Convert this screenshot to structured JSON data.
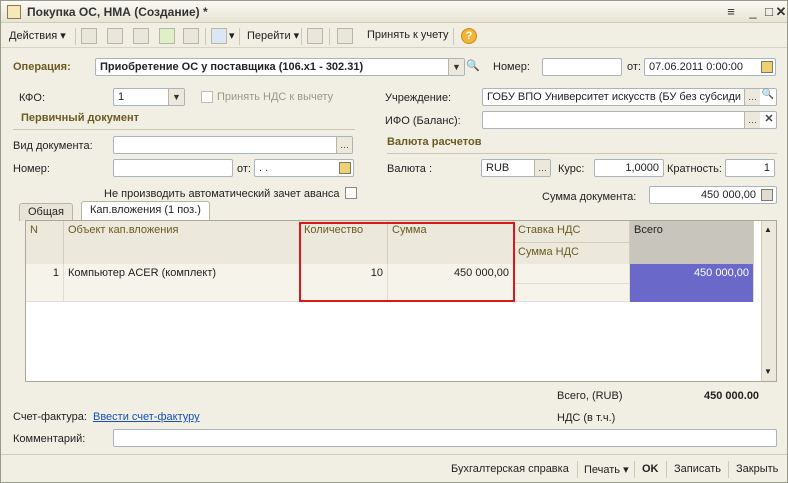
{
  "window": {
    "title": "Покупка ОС, НМА (Создание) *"
  },
  "toolbar": {
    "actions": "Действия",
    "goto": "Перейти",
    "accept_accounting": "Принять к учету",
    "help": "?"
  },
  "header": {
    "operation_label": "Операция:",
    "operation_value": "Приобретение ОС у поставщика (106.x1 - 302.31)",
    "number_label": "Номер:",
    "number_value": "",
    "date_label": "от:",
    "date_value": "07.06.2011  0:00:00",
    "kfo_label": "КФО:",
    "kfo_value": "1",
    "vat_checkbox_label": "Принять НДС к вычету",
    "institution_label": "Учреждение:",
    "institution_value": "ГОБУ ВПО Университет искусств (БУ без субсиди",
    "ifo_label": "ИФО (Баланс):",
    "ifo_value": ""
  },
  "primary_doc": {
    "section_title": "Первичный документ",
    "doc_type_label": "Вид документа:",
    "doc_type_value": "",
    "number_label": "Номер:",
    "number_value": "",
    "date_label": "от:",
    "date_value": " .  .  "
  },
  "currency": {
    "section_title": "Валюта расчетов",
    "currency_label": "Валюта :",
    "currency_value": "RUB",
    "rate_label": "Курс:",
    "rate_value": "1,0000",
    "multiplicity_label": "Кратность:",
    "multiplicity_value": "1",
    "doc_sum_label": "Сумма документа:",
    "doc_sum_value": "450 000,00"
  },
  "advance_checkbox_label": "Не производить автоматический зачет аванса",
  "tabs": [
    {
      "label": "Общая"
    },
    {
      "label": "Кап.вложения (1 поз.)"
    }
  ],
  "grid": {
    "headers": {
      "n": "N",
      "object": "Объект кап.вложения",
      "quantity": "Количество",
      "sum": "Сумма",
      "vat_rate": "Ставка НДС",
      "vat_sum": "Сумма НДС",
      "total": "Всего"
    },
    "rows": [
      {
        "n": "1",
        "object": "Компьютер ACER (комплект)",
        "quantity": "10",
        "sum": "450 000,00",
        "vat_rate": "",
        "vat_sum": "",
        "total": "450 000,00"
      }
    ]
  },
  "totals": {
    "total_label": "Всего, (RUB)",
    "total_value": "450 000.00",
    "vat_label": "НДС (в т.ч.)",
    "vat_value": ""
  },
  "invoice": {
    "label": "Счет-фактура:",
    "link": "Ввести счет-фактуру"
  },
  "comment": {
    "label": "Комментарий:",
    "value": ""
  },
  "bottom": {
    "accounting_ref": "Бухгалтерская справка",
    "print": "Печать",
    "ok": "OK",
    "save": "Записать",
    "close": "Закрыть"
  },
  "colors": {
    "highlight_border": "#d9181c",
    "selected_cell": "#6a68c8",
    "section_title": "#6b5a22"
  }
}
